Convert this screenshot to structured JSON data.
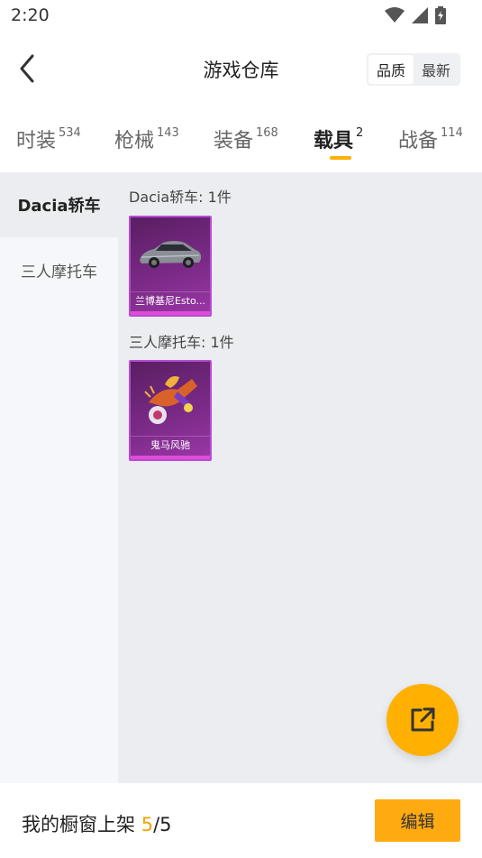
{
  "status": {
    "time": "2:20"
  },
  "header": {
    "title": "游戏仓库",
    "sort_options": [
      "品质",
      "最新"
    ]
  },
  "tabs": [
    {
      "label": "时装",
      "count": "534"
    },
    {
      "label": "枪械",
      "count": "143"
    },
    {
      "label": "装备",
      "count": "168"
    },
    {
      "label": "载具",
      "count": "2"
    },
    {
      "label": "战备",
      "count": "114"
    }
  ],
  "sidebar": {
    "items": [
      "Dacia轿车",
      "三人摩托车"
    ]
  },
  "groups": [
    {
      "title": "Dacia轿车: 1件",
      "item_name": "兰博基尼Esto...",
      "item_icon": "sports-car-icon"
    },
    {
      "title": "三人摩托车: 1件",
      "item_name": "鬼马风驰",
      "item_icon": "motorcycle-icon"
    }
  ],
  "footer": {
    "label": "我的橱窗上架",
    "shelved": "5",
    "separator": "/",
    "capacity": "5",
    "edit_label": "编辑"
  },
  "colors": {
    "accent": "#ffb000",
    "card_border": "#b74bd6",
    "card_bg": "#7a2a86"
  }
}
